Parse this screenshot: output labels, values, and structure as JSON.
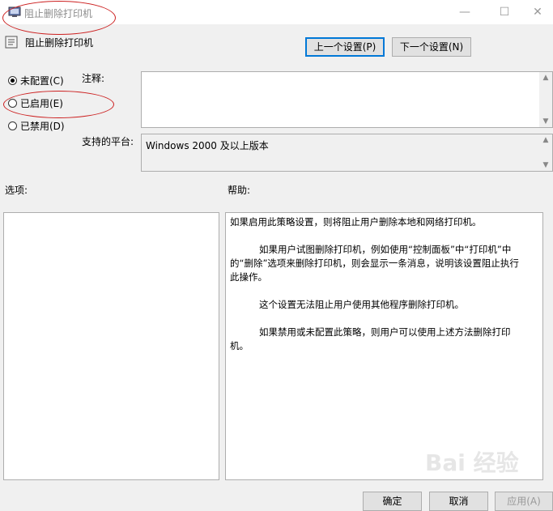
{
  "window": {
    "title": "阻止删除打印机",
    "minimize_glyph": "—",
    "maximize_glyph": "☐",
    "close_glyph": "✕"
  },
  "policy": {
    "name": "阻止删除打印机"
  },
  "nav": {
    "prev_label": "上一个设置(P)",
    "next_label": "下一个设置(N)"
  },
  "radios": [
    {
      "label": "未配置(C)",
      "checked": true
    },
    {
      "label": "已启用(E)",
      "checked": false
    },
    {
      "label": "已禁用(D)",
      "checked": false
    }
  ],
  "comment": {
    "label": "注释:",
    "value": ""
  },
  "platform": {
    "label": "支持的平台:",
    "value": "Windows 2000 及以上版本"
  },
  "options": {
    "label": "选项:"
  },
  "help": {
    "label": "帮助:",
    "paragraphs": [
      "如果启用此策略设置，则将阻止用户删除本地和网络打印机。",
      "如果用户试图删除打印机，例如使用“控制面板”中“打印机”中的“删除”选项来删除打印机，则会显示一条消息，说明该设置阻止执行此操作。",
      "这个设置无法阻止用户使用其他程序删除打印机。",
      "如果禁用或未配置此策略，则用户可以使用上述方法删除打印机。"
    ]
  },
  "footer": {
    "ok_label": "确定",
    "cancel_label": "取消",
    "apply_label": "应用(A)"
  },
  "watermark": "Bai 经验",
  "colors": {
    "annotation": "#cc1f1f",
    "focus": "#0078d7"
  }
}
